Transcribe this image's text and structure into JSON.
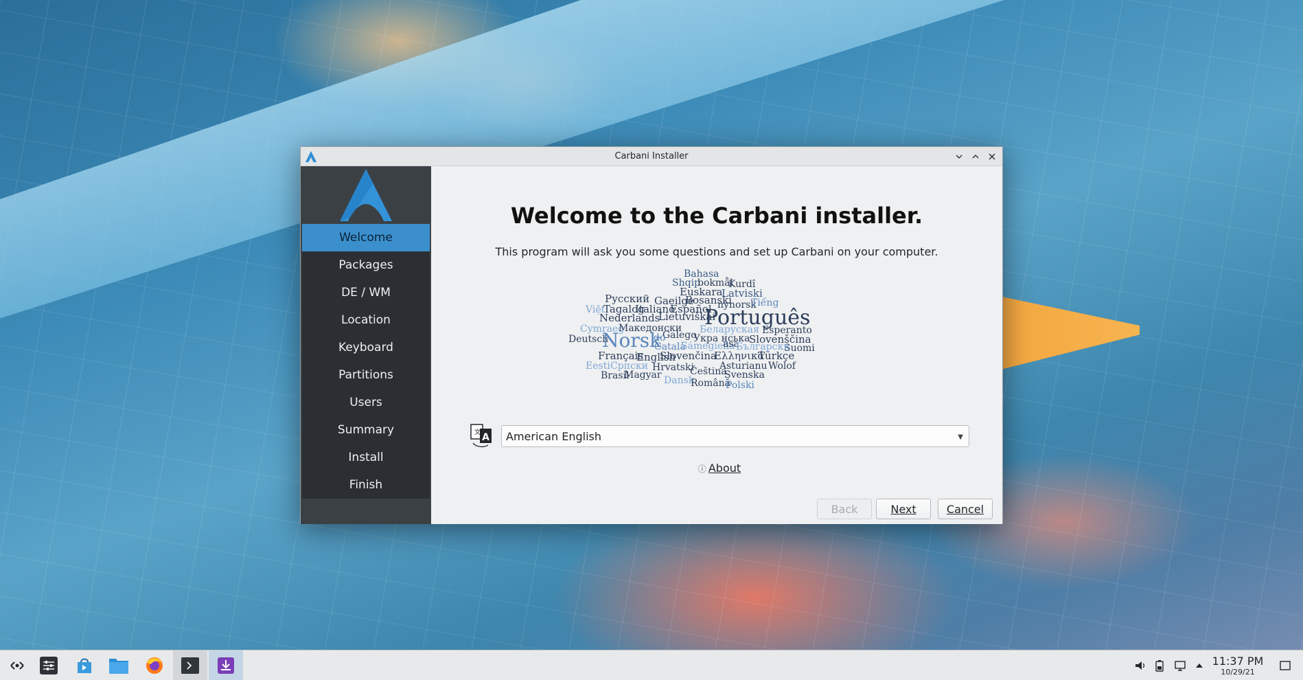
{
  "window": {
    "title": "Carbani Installer",
    "controls": {
      "minimize": "minimize-icon",
      "maximize": "maximize-icon",
      "close": "close-icon"
    }
  },
  "sidebar": {
    "items": [
      {
        "label": "Welcome",
        "active": true
      },
      {
        "label": "Packages"
      },
      {
        "label": "DE / WM"
      },
      {
        "label": "Location"
      },
      {
        "label": "Keyboard"
      },
      {
        "label": "Partitions"
      },
      {
        "label": "Users"
      },
      {
        "label": "Summary"
      },
      {
        "label": "Install"
      },
      {
        "label": "Finish"
      }
    ]
  },
  "main": {
    "title": "Welcome to the Carbani installer.",
    "subtitle": "This program will ask you some questions and set up Carbani on your computer.",
    "wordcloud": [
      "Bahasa",
      "Shqip",
      "bokmål",
      "Kurdî",
      "Euskara",
      "Latviski",
      "Русский",
      "Gaeilge",
      "Bosanski",
      "Tagalog",
      "Italiano",
      "Español",
      "nynorsk",
      "Tiếng",
      "Việt",
      "Nederlands",
      "Lietuviškai",
      "Português",
      "Cymraeg",
      "Македонски",
      "Беларуская",
      "Esperanto",
      "Deutsch",
      "Norsk",
      "Galego",
      "Укра нська",
      "Slovenščina",
      "Català",
      "Sámegiella",
      "Suomi",
      "Français",
      "English",
      "Slovenčina",
      "Ελληνικά",
      "Türkçe",
      "Eesti",
      "Српски",
      "Hrvatski",
      "Asturianu",
      "Wolof",
      "Brasil",
      "Magyar",
      "Čeština",
      "Svenska",
      "Dansk",
      "Română",
      "Polski",
      "do",
      "asa",
      "Български"
    ],
    "language": {
      "selected": "American English"
    },
    "about_label": "About",
    "buttons": {
      "back": "Back",
      "next": "Next",
      "cancel": "Cancel"
    }
  },
  "taskbar": {
    "apps": [
      "application-launcher-icon",
      "system-settings-icon",
      "discover-store-icon",
      "file-manager-icon",
      "firefox-icon",
      "terminal-icon",
      "installer-icon"
    ],
    "tray": [
      "volume-icon",
      "battery-icon",
      "network-icon",
      "expand-tray-icon"
    ],
    "clock": {
      "time": "11:37 PM",
      "date": "10/29/21"
    },
    "show_desktop": "show-desktop-icon"
  },
  "colors": {
    "accent": "#3b8fcc",
    "sidebar": "#3b4045",
    "window_bg": "#eff0f1"
  }
}
